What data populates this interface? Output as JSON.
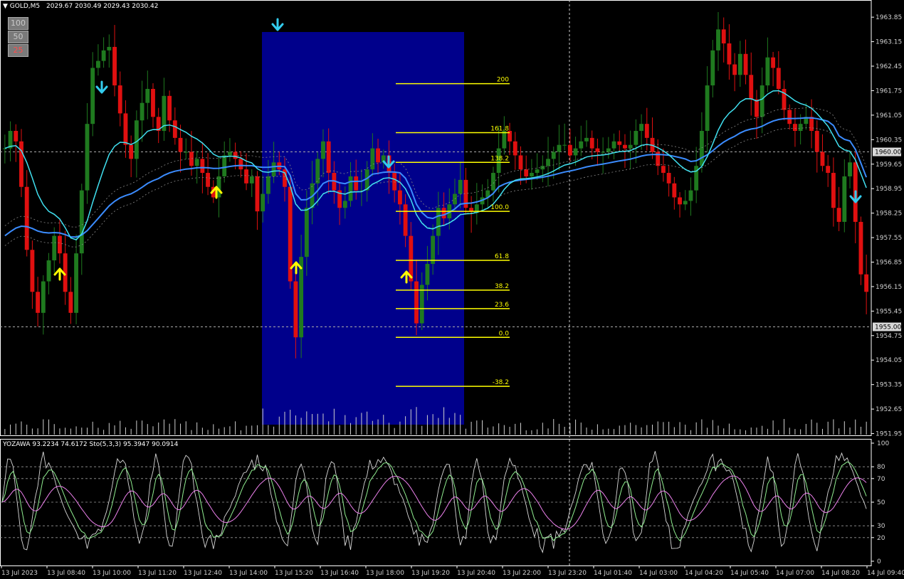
{
  "header": {
    "symbol": "GOLD,M5",
    "ohlc": "2029.67 2030.49 2029.43 2030.42"
  },
  "level_buttons": [
    {
      "label": "100",
      "color": "#cfcfcf"
    },
    {
      "label": "50",
      "color": "#cfcfcf"
    },
    {
      "label": "25",
      "color": "#ff4d4d"
    }
  ],
  "indicator_header": "YOZAWA 93.2234 74.6172  Sto(5,3,3) 95.3947 90.0914",
  "colors": {
    "background": "#000000",
    "bull": "#1f7a1f",
    "bear": "#e01010",
    "fast_ma": "#40e0f0",
    "slow_ma": "#3b8cff",
    "fib": "#ffff00",
    "box": "#00008b",
    "up_arrow": "#ffff00",
    "down_arrow": "#33ccee",
    "osc_white": "#d8d8d8",
    "osc_green": "#90ee90",
    "osc_pink": "#ee82ee"
  },
  "chart_data": {
    "type": "candlestick",
    "symbol": "GOLD",
    "timeframe": "M5",
    "y_ticks": [
      "1963.85",
      "1963.15",
      "1962.45",
      "1961.75",
      "1961.05",
      "1960.35",
      "1959.65",
      "1958.95",
      "1958.25",
      "1957.55",
      "1956.85",
      "1956.15",
      "1955.45",
      "1954.75",
      "1954.05",
      "1953.35",
      "1952.65",
      "1951.95"
    ],
    "ylim": [
      1951.9,
      1964.3
    ],
    "highlight_prices": [
      "1960.00",
      "1955.00"
    ],
    "x_labels": [
      "13 Jul 2023",
      "13 Jul 08:40",
      "13 Jul 10:00",
      "13 Jul 11:20",
      "13 Jul 12:40",
      "13 Jul 14:00",
      "13 Jul 15:20",
      "13 Jul 16:40",
      "13 Jul 18:00",
      "13 Jul 19:20",
      "13 Jul 20:40",
      "13 Jul 22:00",
      "13 Jul 23:20",
      "14 Jul 01:40",
      "14 Jul 03:00",
      "14 Jul 04:20",
      "14 Jul 05:40",
      "14 Jul 07:00",
      "14 Jul 08:20",
      "14 Jul 09:40"
    ],
    "fib_levels": [
      {
        "label": "200",
        "price": 1961.95
      },
      {
        "label": "161.8",
        "price": 1960.55
      },
      {
        "label": "138.2",
        "price": 1959.7
      },
      {
        "label": "100.0",
        "price": 1958.3
      },
      {
        "label": "61.8",
        "price": 1956.9
      },
      {
        "label": "38.2",
        "price": 1956.05
      },
      {
        "label": "23.6",
        "price": 1955.52
      },
      {
        "label": "0.0",
        "price": 1954.7
      },
      {
        "label": "-38.2",
        "price": 1953.3
      }
    ],
    "close_series": [
      1960.1,
      1960.6,
      1960.3,
      1959.0,
      1957.2,
      1956.0,
      1955.4,
      1956.3,
      1956.9,
      1957.6,
      1957.1,
      1956.0,
      1955.4,
      1957.1,
      1958.9,
      1960.8,
      1962.4,
      1962.6,
      1962.9,
      1963.0,
      1961.9,
      1961.1,
      1960.2,
      1959.8,
      1960.9,
      1961.4,
      1961.8,
      1961.0,
      1960.6,
      1961.6,
      1960.9,
      1960.4,
      1960.0,
      1960.0,
      1959.6,
      1959.8,
      1959.4,
      1959.0,
      1958.7,
      1959.3,
      1959.9,
      1960.0,
      1959.8,
      1959.5,
      1959.1,
      1959.3,
      1958.3,
      1958.8,
      1959.3,
      1959.7,
      1959.5,
      1959.0,
      1956.3,
      1954.7,
      1957.0,
      1958.4,
      1959.1,
      1959.8,
      1960.3,
      1959.4,
      1958.9,
      1958.4,
      1958.6,
      1959.3,
      1958.9,
      1958.9,
      1959.5,
      1960.1,
      1959.7,
      1959.9,
      1959.4,
      1958.9,
      1958.5,
      1957.6,
      1956.3,
      1955.1,
      1956.2,
      1956.8,
      1957.6,
      1958.4,
      1958.1,
      1958.5,
      1958.8,
      1959.2,
      1958.4,
      1958.3,
      1958.5,
      1958.7,
      1958.9,
      1959.4,
      1960.1,
      1960.6,
      1960.3,
      1959.9,
      1959.5,
      1959.3,
      1959.4,
      1959.5,
      1959.6,
      1959.8,
      1960.0,
      1960.2,
      1960.2,
      1959.9,
      1960.1,
      1960.3,
      1960.4,
      1960.1,
      1960.0,
      1960.0,
      1960.1,
      1960.3,
      1960.2,
      1960.1,
      1960.2,
      1960.6,
      1960.8,
      1960.4,
      1960.0,
      1959.6,
      1959.4,
      1959.1,
      1958.7,
      1958.5,
      1958.6,
      1958.9,
      1959.6,
      1960.6,
      1961.9,
      1962.9,
      1963.5,
      1963.1,
      1962.5,
      1962.2,
      1962.8,
      1962.2,
      1961.5,
      1961.0,
      1961.9,
      1962.7,
      1962.4,
      1961.8,
      1961.2,
      1960.8,
      1960.6,
      1960.8,
      1961.0,
      1960.6,
      1960.0,
      1959.6,
      1959.4,
      1958.4,
      1958.0,
      1959.3,
      1959.7,
      1958.0,
      1956.5,
      1956.0
    ]
  },
  "oscillator": {
    "levels": [
      "100",
      "80",
      "70",
      "50",
      "30",
      "20",
      "0"
    ]
  }
}
